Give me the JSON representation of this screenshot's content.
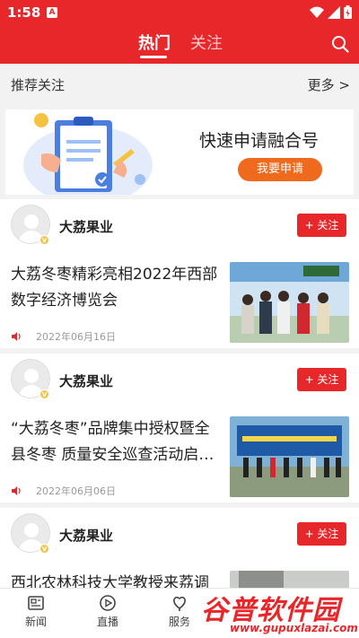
{
  "status_bar": {
    "time": "1:58",
    "a_badge": "A"
  },
  "header": {
    "tabs": [
      {
        "label": "热门",
        "active": true
      },
      {
        "label": "关注",
        "active": false
      }
    ],
    "accent_color": "#e8272b"
  },
  "recommend": {
    "title": "推荐关注",
    "more": "更多 >"
  },
  "banner": {
    "title": "快速申请融合号",
    "button": "我要申请"
  },
  "feed": [
    {
      "author": "大荔果业",
      "follow_label": "+ 关注",
      "title": "大荔冬枣精彩亮相2022年西部数字经济博览会",
      "date": "2022年06月16日"
    },
    {
      "author": "大荔果业",
      "follow_label": "+ 关注",
      "title": "“大荔冬枣”品牌集中授权暨全县冬枣 质量安全巡查活动启…",
      "date": "2022年06月06日"
    },
    {
      "author": "大荔果业",
      "follow_label": "+ 关注",
      "title": "西北农林科技大学教授来荔调",
      "date": ""
    }
  ],
  "bottom_nav": [
    {
      "label": "新闻",
      "icon": "news-icon"
    },
    {
      "label": "直播",
      "icon": "live-icon"
    },
    {
      "label": "服务",
      "icon": "service-icon"
    }
  ],
  "watermark": {
    "main": "谷普软件园",
    "url": "www.gupuxlazai.com"
  }
}
